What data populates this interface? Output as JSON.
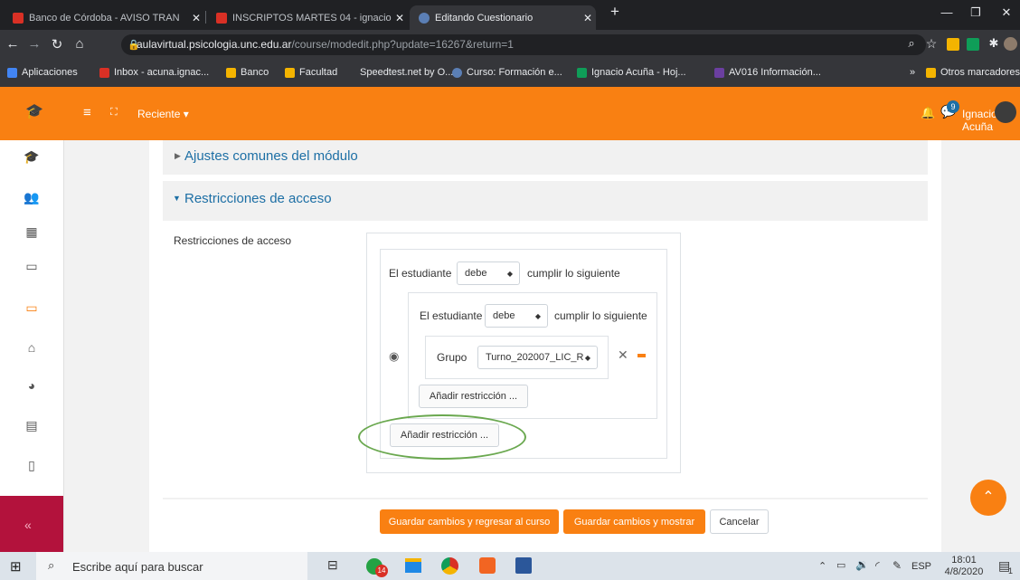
{
  "browser": {
    "tabs": [
      {
        "label": "Banco de Córdoba - AVISO TRAN",
        "icon": "gmail-icon",
        "active": false
      },
      {
        "label": "INSCRIPTOS MARTES 04 - ignacio",
        "icon": "gmail-icon",
        "active": false
      },
      {
        "label": "Editando Cuestionario",
        "icon": "moodle-icon",
        "active": true
      }
    ],
    "new_tab": "+",
    "url_host": "aulavirtual.psicologia.unc.edu.ar",
    "url_path": "/course/modedit.php?update=16267&return=1",
    "bookmarks": [
      {
        "label": "Aplicaciones",
        "color": "#4285f4"
      },
      {
        "label": "Inbox - acuna.ignac...",
        "color": "#d93025"
      },
      {
        "label": "Banco",
        "color": "#f4b400"
      },
      {
        "label": "Facultad",
        "color": "#f4b400"
      },
      {
        "label": "Speedtest.net by O...",
        "color": "#35363a"
      },
      {
        "label": "Curso: Formación e...",
        "color": "#5b7fb5"
      },
      {
        "label": "Ignacio Acuña - Hoj...",
        "color": "#0f9d58"
      },
      {
        "label": "AV016 Información...",
        "color": "#6b3fa0"
      }
    ],
    "more": "»",
    "other_bookmarks": "Otros marcadores"
  },
  "header": {
    "recent_label": "Reciente ▾",
    "notif_count": "9",
    "user_name": "Ignacio Acuña"
  },
  "form": {
    "section_common": "Ajustes comunes del módulo",
    "section_restrict": "Restricciones de acceso",
    "restrict_label": "Restricciones de acceso",
    "outer_prefix": "El estudiante",
    "outer_select": "debe",
    "outer_suffix": "cumplir lo siguiente",
    "inner_prefix": "El estudiante",
    "inner_select": "debe",
    "inner_suffix": "cumplir lo siguiente",
    "group_label": "Grupo",
    "group_value": "Turno_202007_LIC_R",
    "add_restriction_inner": "Añadir restricción ...",
    "add_restriction_outer": "Añadir restricción ...",
    "save_return": "Guardar cambios y regresar al curso",
    "save_show": "Guardar cambios y mostrar",
    "cancel": "Cancelar",
    "highlight_color": "#6aa84f"
  },
  "taskbar": {
    "search_placeholder": "Escribe aquí para buscar",
    "lang": "ESP",
    "time": "18:01",
    "date": "4/8/2020",
    "whatsapp_badge": "14",
    "notif_badge": "1"
  }
}
